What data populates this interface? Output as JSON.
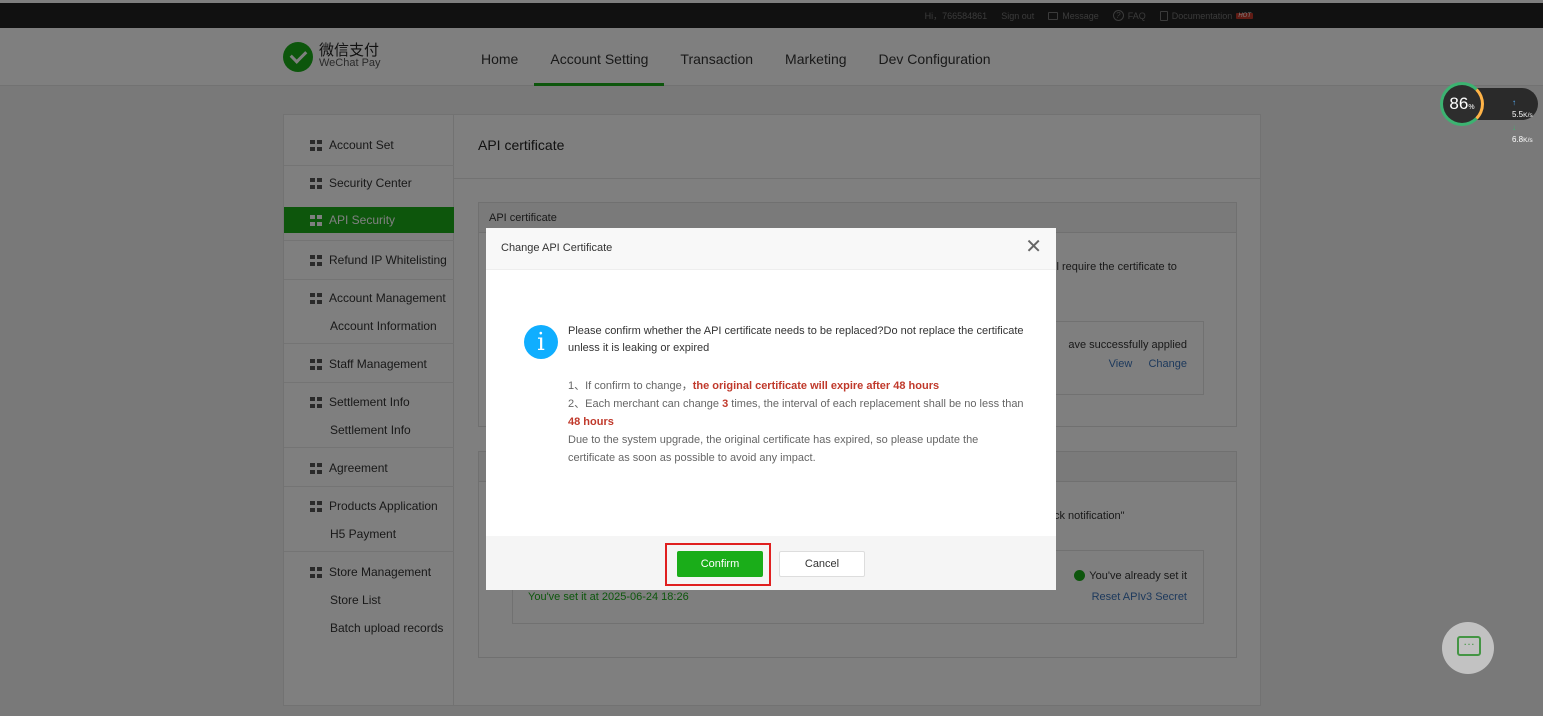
{
  "topbar": {
    "greeting": "Hi，766584861",
    "sign_out": "Sign out",
    "message": "Message",
    "faq": "FAQ",
    "documentation": "Documentation",
    "hot_badge": "HOT"
  },
  "header": {
    "logo_cn": "微信支付",
    "logo_en": "WeChat Pay",
    "nav": [
      "Home",
      "Account Setting",
      "Transaction",
      "Marketing",
      "Dev Configuration"
    ],
    "active_nav": "Account Setting"
  },
  "sidebar": {
    "items": [
      {
        "label": "Account Set"
      },
      {
        "label": "Security Center"
      },
      {
        "label": "API Security"
      },
      {
        "label": "Refund IP Whitelisting"
      },
      {
        "label": "Account Management"
      },
      {
        "label": "Account Information"
      },
      {
        "label": "Staff Management"
      },
      {
        "label": "Settlement Info"
      },
      {
        "label": "Settlement Info"
      },
      {
        "label": "Agreement"
      },
      {
        "label": "Products Application"
      },
      {
        "label": "H5 Payment"
      },
      {
        "label": "Store Management"
      },
      {
        "label": "Store List"
      },
      {
        "label": "Batch upload records"
      }
    ],
    "active": "API Security"
  },
  "content": {
    "title": "API certificate",
    "section1": {
      "header": "API certificate",
      "partial_text": "ll require the certificate to",
      "status_partial": "ave successfully applied",
      "view_link": "View",
      "change_link": "Change"
    },
    "section2": {
      "partial_text": "ck notification\"",
      "set_time": "You've set it at 2025-06-24 18:26",
      "status": "You've already set it",
      "reset_link": "Reset APIv3 Secret"
    }
  },
  "modal": {
    "title": "Change API Certificate",
    "message": "Please confirm whether the API certificate needs to be replaced?Do not replace the certificate unless it is leaking or expired",
    "note1_prefix": "1、If confirm to change，",
    "note1_highlight": "the original certificate will expire after 48 hours",
    "note2_prefix": "2、Each merchant can change ",
    "note2_count": "3",
    "note2_middle": " times, the interval of each replacement shall be no less than ",
    "note2_highlight": "48 hours",
    "note3": "Due to the system upgrade, the original certificate has expired, so please update the certificate as soon as possible to avoid any impact.",
    "confirm_label": "Confirm",
    "cancel_label": "Cancel"
  },
  "widget": {
    "percent": "86",
    "percent_unit": "%",
    "upload_value": "5.5",
    "download_value": "6.8",
    "speed_unit": "K/s"
  },
  "colors": {
    "brand_green": "#1aad19",
    "warning_red": "#c0392b",
    "link_blue": "#3b73b9",
    "info_blue": "#10aeff"
  }
}
